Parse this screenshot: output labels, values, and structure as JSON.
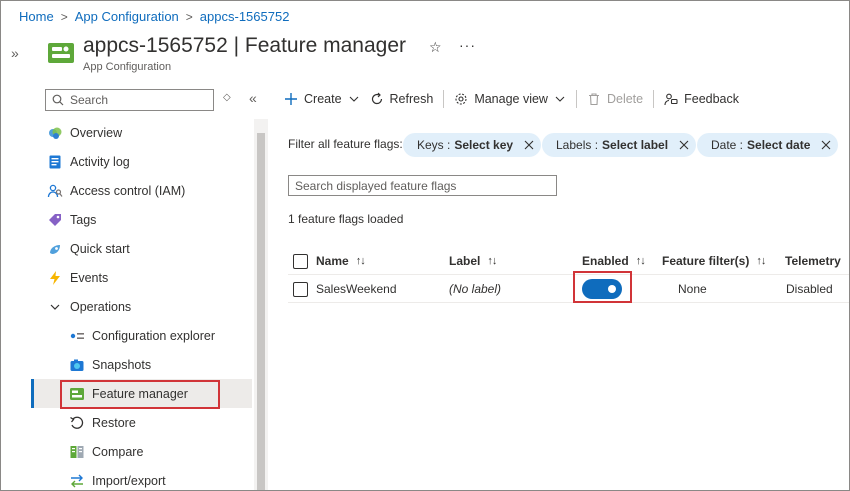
{
  "breadcrumb": {
    "home": "Home",
    "app_config": "App Configuration",
    "resource": "appcs-1565752"
  },
  "header": {
    "title": "appcs-1565752 | Feature manager",
    "subtitle": "App Configuration",
    "favorite_icon": "star-icon",
    "more_icon": "ellipsis-icon"
  },
  "sidebar": {
    "search_placeholder": "Search",
    "items": [
      {
        "label": "Overview",
        "icon": "overview-icon"
      },
      {
        "label": "Activity log",
        "icon": "activity-log-icon"
      },
      {
        "label": "Access control (IAM)",
        "icon": "iam-icon"
      },
      {
        "label": "Tags",
        "icon": "tag-icon"
      },
      {
        "label": "Quick start",
        "icon": "quick-start-icon"
      },
      {
        "label": "Events",
        "icon": "lightning-icon"
      },
      {
        "label": "Operations",
        "icon": "chevron-down-icon"
      },
      {
        "label": "Configuration explorer",
        "icon": "config-explorer-icon"
      },
      {
        "label": "Snapshots",
        "icon": "camera-icon"
      },
      {
        "label": "Feature manager",
        "icon": "feature-manager-icon",
        "selected": true
      },
      {
        "label": "Restore",
        "icon": "restore-icon"
      },
      {
        "label": "Compare",
        "icon": "compare-icon"
      },
      {
        "label": "Import/export",
        "icon": "import-export-icon"
      }
    ]
  },
  "toolbar": {
    "create": "Create",
    "refresh": "Refresh",
    "manage_view": "Manage view",
    "delete": "Delete",
    "feedback": "Feedback"
  },
  "filters": {
    "label": "Filter all feature flags:",
    "keys": {
      "name": "Keys :",
      "value": "Select key"
    },
    "labels": {
      "name": "Labels :",
      "value": "Select label"
    },
    "date": {
      "name": "Date :",
      "value": "Select date"
    }
  },
  "flag_search": {
    "placeholder": "Search displayed feature flags"
  },
  "status": {
    "loaded": "1 feature flags loaded"
  },
  "table": {
    "columns": {
      "name": "Name",
      "label": "Label",
      "enabled": "Enabled",
      "filters": "Feature filter(s)",
      "telemetry": "Telemetry"
    },
    "sort_glyph": "↑↓",
    "rows": [
      {
        "name": "SalesWeekend",
        "label": "(No label)",
        "enabled": true,
        "filters": "None",
        "telemetry": "Disabled"
      }
    ]
  },
  "colors": {
    "accent": "#0f6cbd",
    "highlight": "#d13438",
    "pill_bg": "#e1effa"
  }
}
